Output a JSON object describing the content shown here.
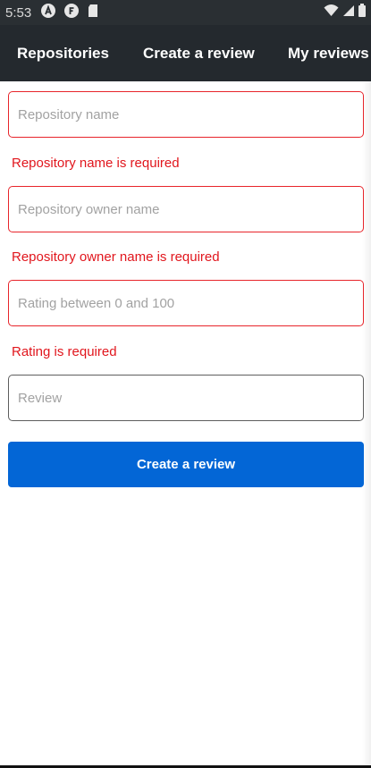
{
  "status_bar": {
    "time": "5:53",
    "left_icons": [
      "a-circle-icon",
      "f-circle-icon",
      "sd-card-icon"
    ],
    "right_icons": [
      "wifi-icon",
      "signal-icon",
      "battery-icon"
    ]
  },
  "app_bar": {
    "tabs": [
      {
        "label": "Repositories"
      },
      {
        "label": "Create a review"
      },
      {
        "label": "My reviews"
      }
    ]
  },
  "form": {
    "repository_name": {
      "placeholder": "Repository name",
      "value": "",
      "error": "Repository name is required"
    },
    "owner_name": {
      "placeholder": "Repository owner name",
      "value": "",
      "error": "Repository owner name is required"
    },
    "rating": {
      "placeholder": "Rating between 0 and 100",
      "value": "",
      "error": "Rating is required"
    },
    "review": {
      "placeholder": "Review",
      "value": ""
    },
    "submit_label": "Create a review"
  },
  "colors": {
    "app_bar": "#24292e",
    "error": "#e1161d",
    "primary": "#0366d6"
  }
}
